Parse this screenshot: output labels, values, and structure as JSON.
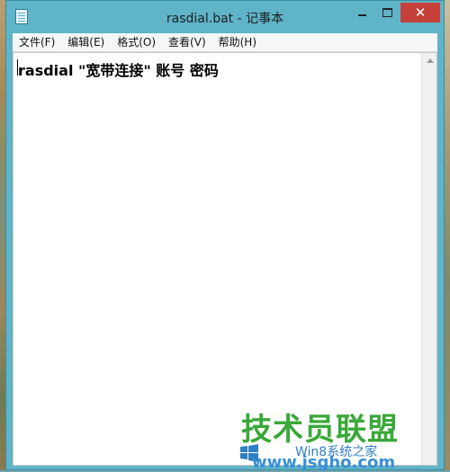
{
  "window": {
    "title": "rasdial.bat - 记事本",
    "close_glyph": "✕"
  },
  "menu": [
    {
      "label": "文件(F)"
    },
    {
      "label": "编辑(E)"
    },
    {
      "label": "格式(O)"
    },
    {
      "label": "查看(V)"
    },
    {
      "label": "帮助(H)"
    }
  ],
  "editor": {
    "text": "rasdial \"宽带连接\" 账号 密码"
  },
  "watermark": {
    "brand": "技术员联盟",
    "sub": "Win8系统之家",
    "url": "www.jsgho.com"
  },
  "colors": {
    "window_frame": "#5fb4c8",
    "close_button": "#c6403a",
    "watermark_green": "#39a839",
    "watermark_blue": "#3a8fd6"
  }
}
